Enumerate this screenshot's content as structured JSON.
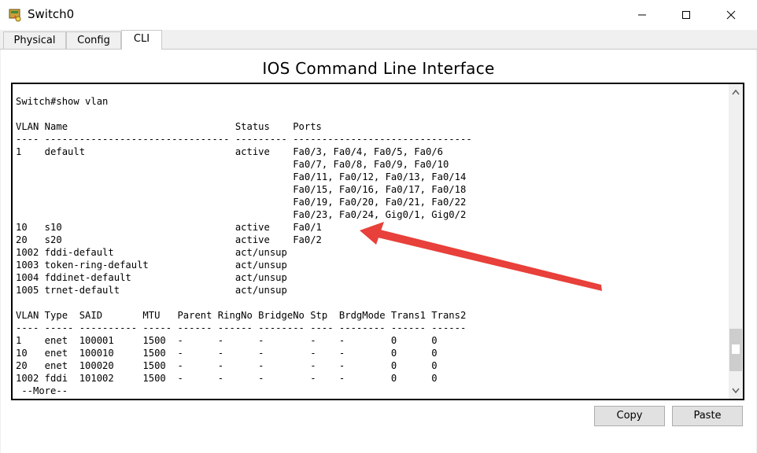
{
  "window": {
    "title": "Switch0",
    "icons": {
      "app": "switch-device-icon",
      "minimize": "minimize-icon",
      "maximize": "maximize-icon",
      "close": "close-icon"
    }
  },
  "tabs": [
    {
      "label": "Physical",
      "active": false
    },
    {
      "label": "Config",
      "active": false
    },
    {
      "label": "CLI",
      "active": true
    }
  ],
  "cli": {
    "heading": "IOS Command Line Interface",
    "lines": [
      "Switch#show vlan",
      "",
      "VLAN Name                             Status    Ports",
      "---- -------------------------------- --------- -------------------------------",
      "1    default                          active    Fa0/3, Fa0/4, Fa0/5, Fa0/6",
      "                                                Fa0/7, Fa0/8, Fa0/9, Fa0/10",
      "                                                Fa0/11, Fa0/12, Fa0/13, Fa0/14",
      "                                                Fa0/15, Fa0/16, Fa0/17, Fa0/18",
      "                                                Fa0/19, Fa0/20, Fa0/21, Fa0/22",
      "                                                Fa0/23, Fa0/24, Gig0/1, Gig0/2",
      "10   s10                              active    Fa0/1",
      "20   s20                              active    Fa0/2",
      "1002 fddi-default                     act/unsup",
      "1003 token-ring-default               act/unsup",
      "1004 fddinet-default                  act/unsup",
      "1005 trnet-default                    act/unsup",
      "",
      "VLAN Type  SAID       MTU   Parent RingNo BridgeNo Stp  BrdgMode Trans1 Trans2",
      "---- ----- ---------- ----- ------ ------ -------- ---- -------- ------ ------",
      "1    enet  100001     1500  -      -      -        -    -        0      0",
      "10   enet  100010     1500  -      -      -        -    -        0      0",
      "20   enet  100020     1500  -      -      -        -    -        0      0",
      "1002 fddi  101002     1500  -      -      -        -    -        0      0",
      " --More--"
    ]
  },
  "scrollbar": {
    "up_icon": "chevron-up-icon",
    "down_icon": "chevron-down-icon",
    "position_fraction": 0.95
  },
  "annotation": {
    "icon": "red-arrow-icon",
    "color": "#e8403a"
  },
  "buttons": {
    "copy": "Copy",
    "paste": "Paste"
  }
}
